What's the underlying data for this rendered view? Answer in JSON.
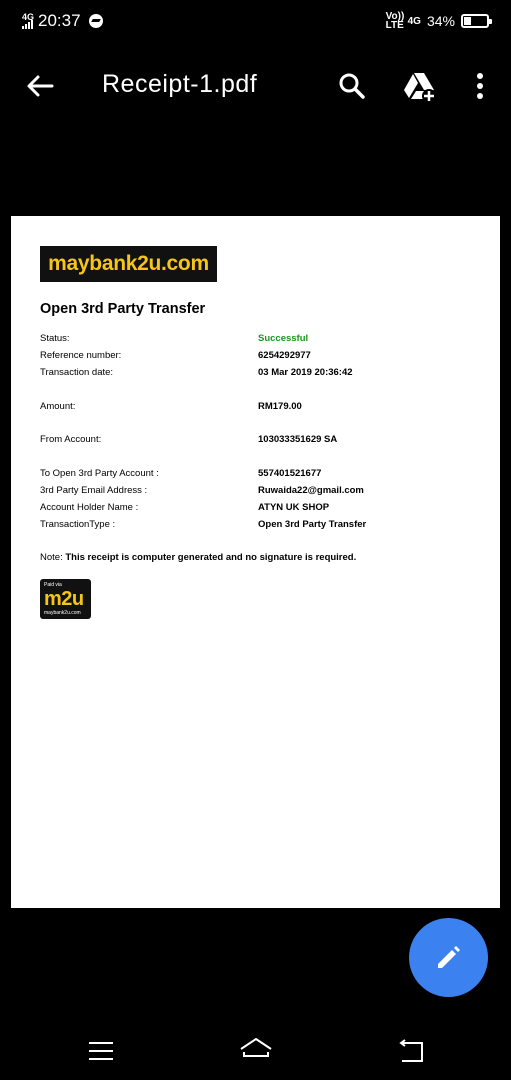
{
  "status_bar": {
    "network": "4G",
    "time": "20:37",
    "volte": "Vo)) LTE",
    "network2": "4G",
    "battery": "34%",
    "battery_level": 0.34
  },
  "toolbar": {
    "title": "Receipt-1.pdf",
    "back_icon": "arrow-left-icon",
    "search_icon": "search-icon",
    "drive_icon": "drive-add-icon",
    "more_icon": "more-vert-icon"
  },
  "receipt": {
    "logo_text": "maybank2u.com",
    "title": "Open 3rd Party Transfer",
    "rows": [
      {
        "label": "Status:",
        "value": "Successful"
      },
      {
        "label": "Reference number:",
        "value": "6254292977"
      },
      {
        "label": "Transaction date:",
        "value": "03 Mar 2019 20:36:42"
      },
      {
        "label": "Amount:",
        "value": "RM179.00"
      },
      {
        "label": "From Account:",
        "value": "103033351629 SA"
      },
      {
        "label": "To Open 3rd Party Account :",
        "value": "557401521677"
      },
      {
        "label": "3rd Party Email Address :",
        "value": "Ruwaida22@gmail.com"
      },
      {
        "label": "Account Holder Name :",
        "value": "ATYN UK SHOP"
      },
      {
        "label": "TransactionType :",
        "value": "Open 3rd Party Transfer"
      }
    ],
    "note_prefix": "Note:",
    "note_text": "This receipt is computer generated and no signature is required.",
    "badge_paid": "Paid via",
    "badge_big": "m2u",
    "badge_small": "maybank2u.com"
  },
  "colors": {
    "success": "#1a9a1a",
    "fab": "#3b82f0",
    "brand_yellow": "#f5c517"
  },
  "fab": {
    "icon": "pencil-icon"
  },
  "navbar": {
    "menu_icon": "menu-icon",
    "home_icon": "home-icon",
    "back_icon": "back-icon"
  }
}
